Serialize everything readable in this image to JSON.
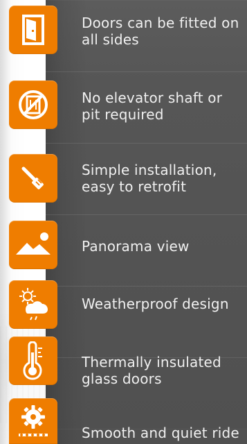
{
  "features": [
    {
      "icon": "door-icon",
      "lines": [
        "Doors can be fitted on",
        "all sides"
      ]
    },
    {
      "icon": "no-elevator-shaft-icon",
      "lines": [
        "No elevator shaft or",
        "pit required"
      ]
    },
    {
      "icon": "screwdriver-icon",
      "lines": [
        "Simple installation,",
        "easy to retrofit"
      ]
    },
    {
      "icon": "panorama-view-icon",
      "lines": [
        "Panorama view"
      ]
    },
    {
      "icon": "weather-icon",
      "lines": [
        "Weatherproof design"
      ]
    },
    {
      "icon": "thermometer-icon",
      "lines": [
        "Thermally insulated",
        "glass doors"
      ]
    },
    {
      "icon": "gear-chain-icon",
      "lines": [
        "Smooth and quiet ride"
      ]
    }
  ],
  "colors": {
    "accent": "#ef7d00",
    "panel": "#555555",
    "text": "#f0f0f0"
  }
}
